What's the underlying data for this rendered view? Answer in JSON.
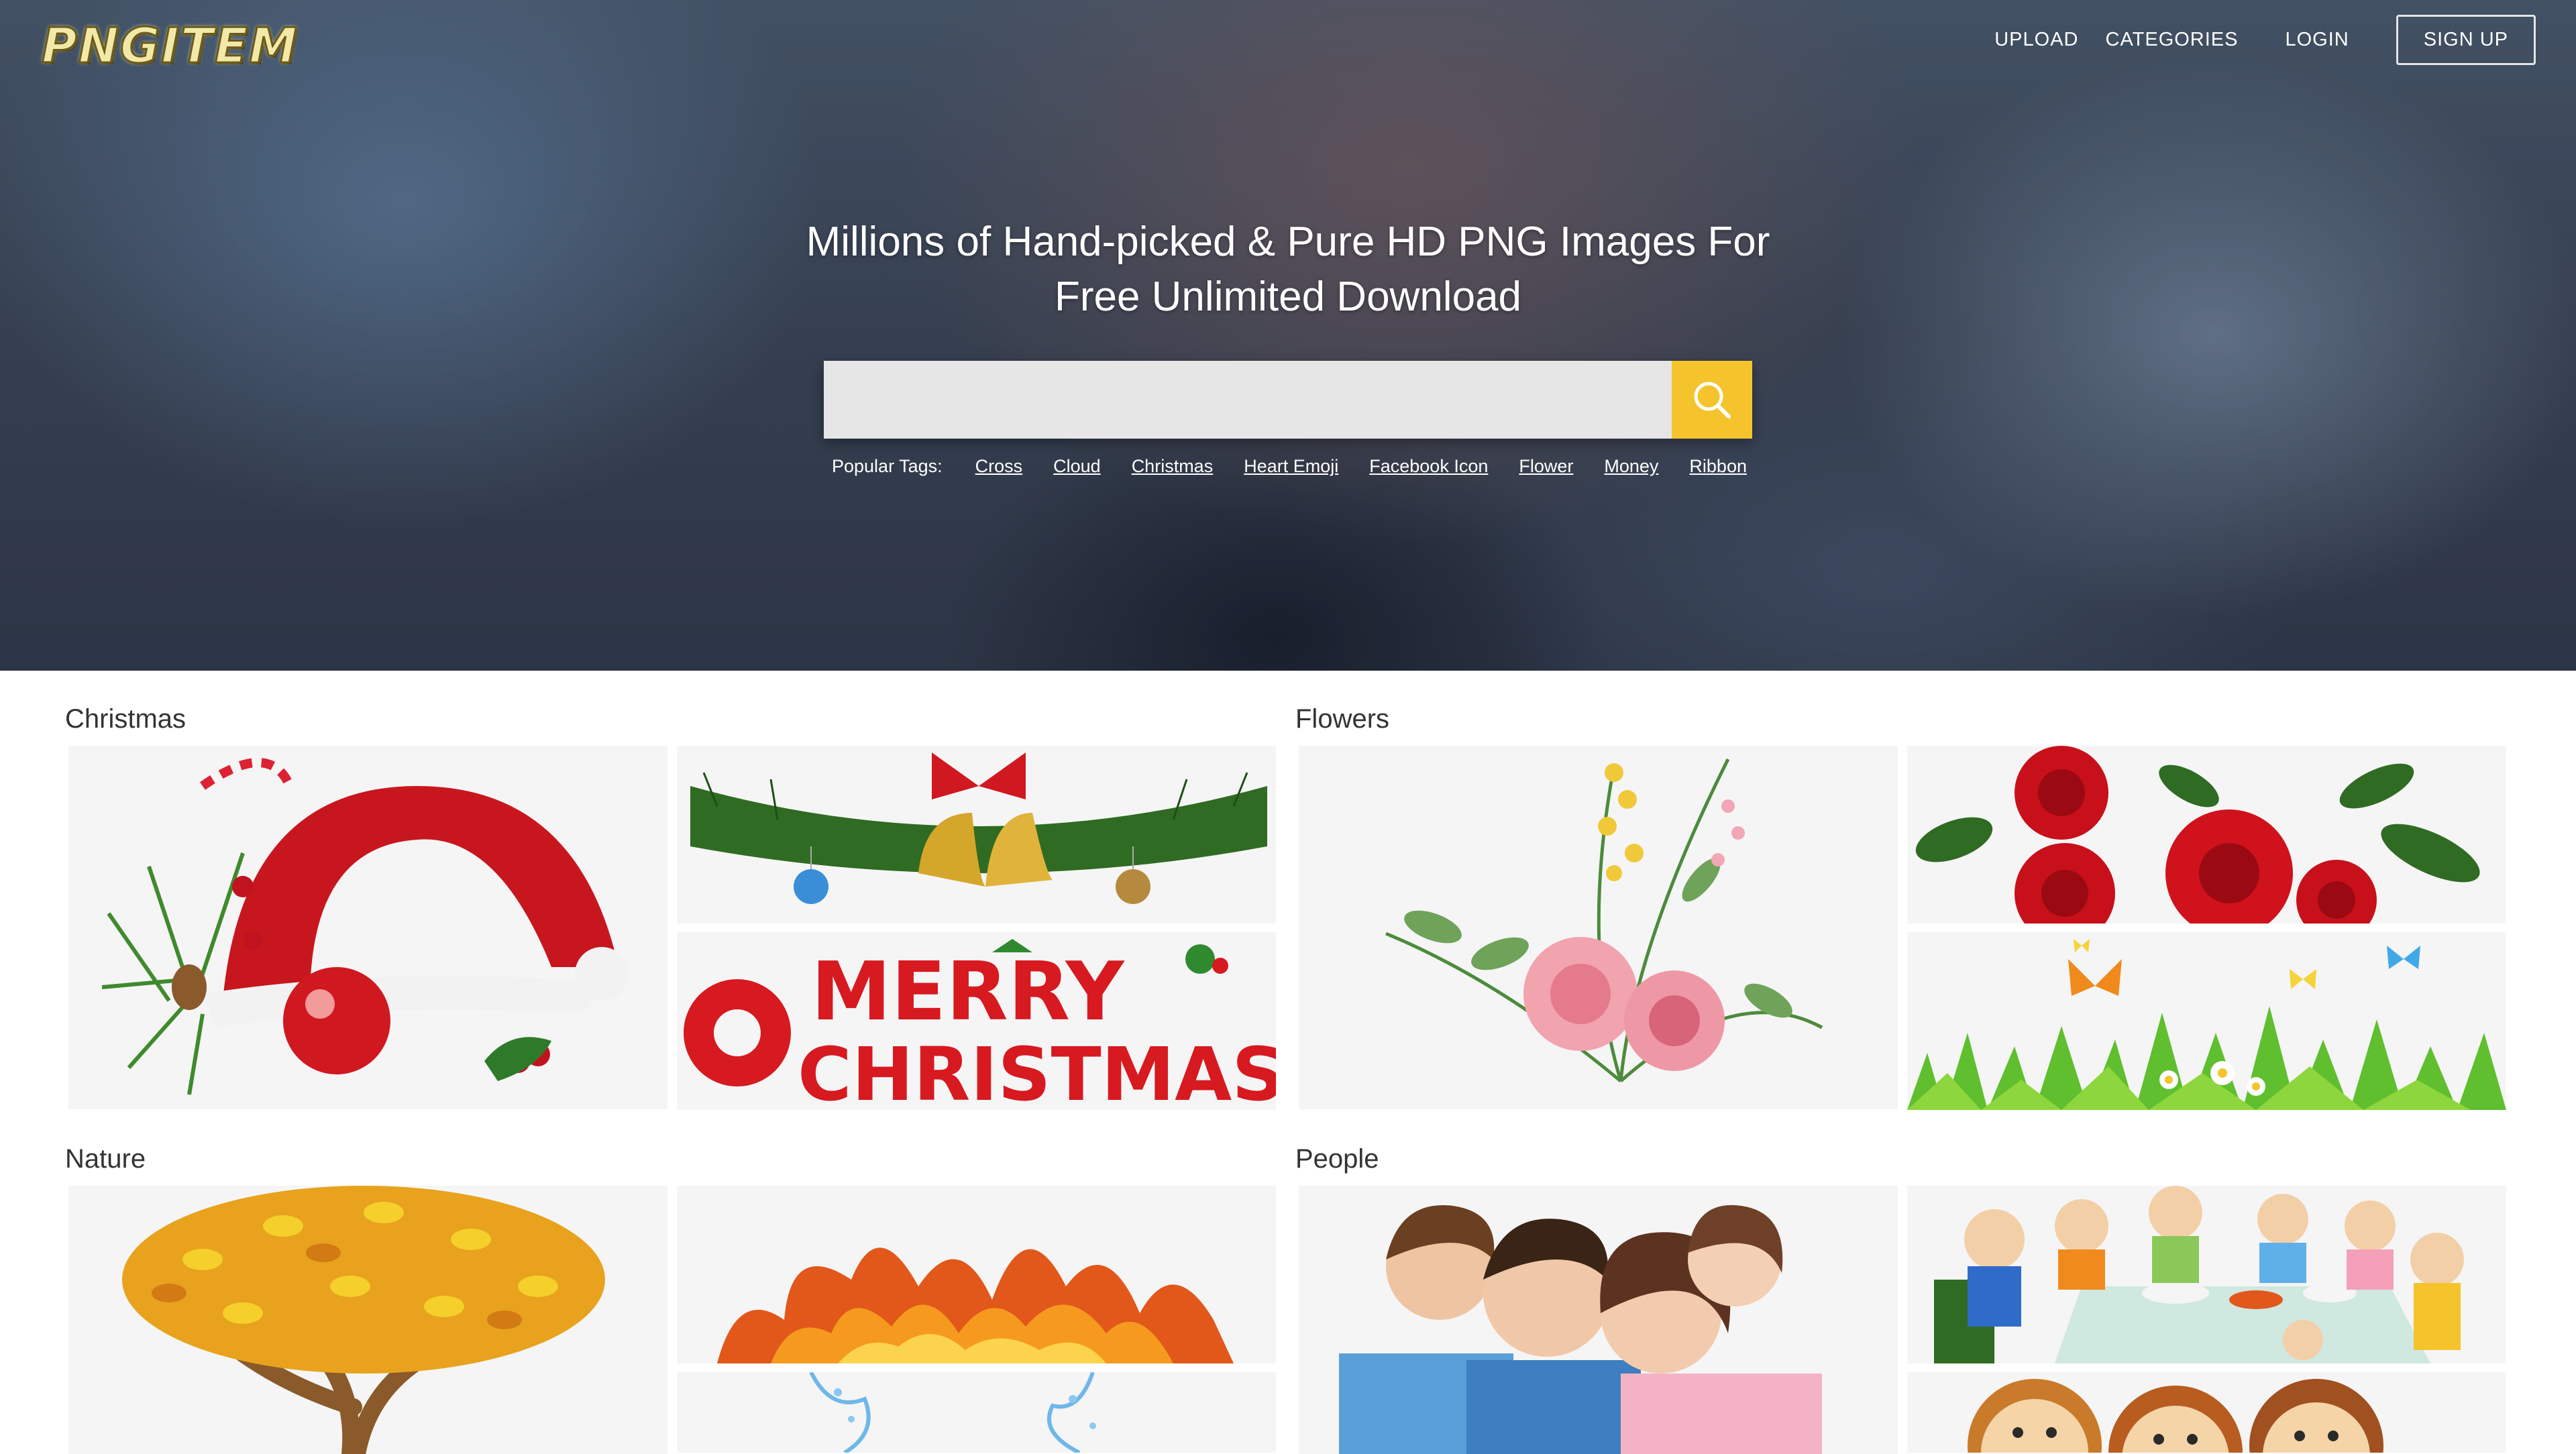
{
  "header": {
    "logo_text": "PNGITEM",
    "nav": {
      "upload": "UPLOAD",
      "categories": "CATEGORIES",
      "login": "LOGIN",
      "signup": "SIGN UP"
    }
  },
  "hero": {
    "headline_line1": "Millions of Hand-picked & Pure HD PNG Images For",
    "headline_line2": "Free Unlimited Download",
    "search": {
      "placeholder": "",
      "value": "",
      "button_icon": "search-icon",
      "button_color": "#f5c42c"
    },
    "popular_tags_label": "Popular Tags:",
    "popular_tags": [
      "Cross",
      "Cloud",
      "Christmas",
      "Heart Emoji",
      "Facebook Icon",
      "Flower",
      "Money",
      "Ribbon"
    ]
  },
  "categories": [
    {
      "title": "Christmas",
      "images": [
        "santa-hat-ornament",
        "christmas-bells-garland",
        "merry-christmas-lettering"
      ]
    },
    {
      "title": "Flowers",
      "images": [
        "watercolor-flower-bouquet",
        "red-roses",
        "butterflies-grass-flowers"
      ]
    },
    {
      "title": "Nature",
      "images": [
        "autumn-tree",
        "fire-flames",
        "water-splash"
      ]
    },
    {
      "title": "People",
      "images": [
        "happy-family",
        "cartoon-family-dinner",
        "cartoon-family-faces"
      ]
    }
  ],
  "image_text": {
    "merry_line1": "MERRY",
    "merry_line2": "CHRISTMAS"
  }
}
